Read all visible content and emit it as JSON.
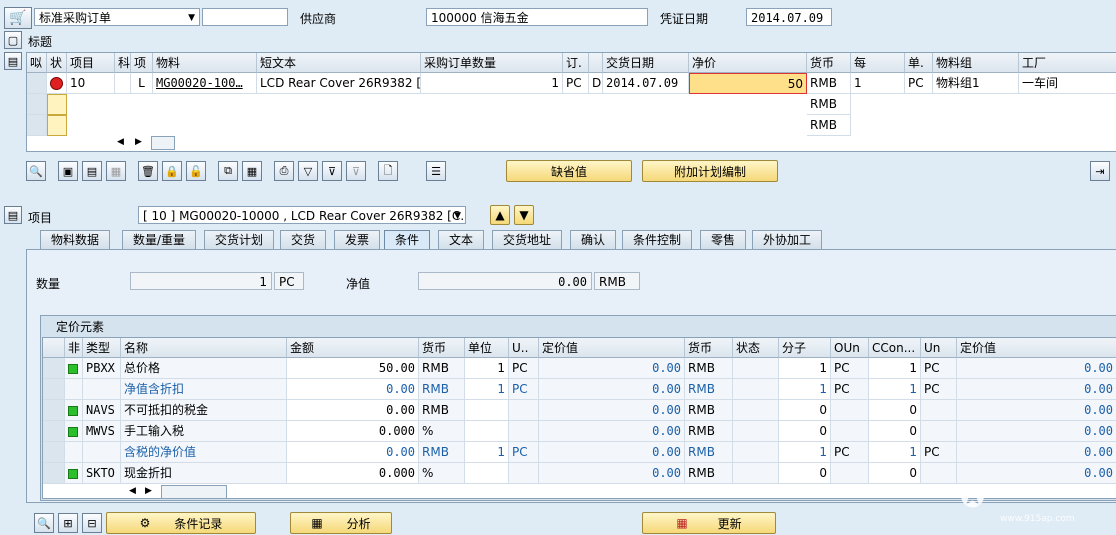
{
  "header": {
    "order_type": "标准采购订单",
    "vendor_label": "供应商",
    "vendor_value": "100000 信海五金",
    "doc_date_label": "凭证日期",
    "doc_date_value": "2014.07.09"
  },
  "title_section": {
    "label": "标题"
  },
  "items_table": {
    "columns": [
      "㕽",
      "状",
      "项目",
      "科",
      "项",
      "物料",
      "短文本",
      "采购订单数量",
      "订.",
      "",
      "交货日期",
      "净价",
      "货币",
      "每",
      "单.",
      "物料组",
      "工厂"
    ],
    "row": {
      "item": "10",
      "acct": "",
      "type": "L",
      "material": "MG00020-100…",
      "short_text": "LCD Rear Cover 26R9382 [C…",
      "qty": "1",
      "unit": "PC",
      "d": "D",
      "delivery_date": "2014.07.09",
      "net_price": "50",
      "currency": "RMB",
      "per": "1",
      "order_unit": "PC",
      "material_group": "物料组1",
      "plant": "一车间"
    },
    "empty_currency": [
      "RMB",
      "RMB"
    ]
  },
  "toolbar": {
    "default_values": "缺省值",
    "additional_planning": "附加计划编制"
  },
  "item_section": {
    "label": "项目",
    "item_select": "[ 10 ] MG00020-10000 , LCD Rear Cover 26R9382 [C…"
  },
  "tabs": [
    "物料数据",
    "数量/重量",
    "交货计划",
    "交货",
    "发票",
    "条件",
    "文本",
    "交货地址",
    "确认",
    "条件控制",
    "零售",
    "外协加工"
  ],
  "active_tab": "条件",
  "conditions": {
    "qty_label": "数量",
    "qty_value": "1",
    "qty_unit": "PC",
    "net_label": "净值",
    "net_value": "0.00",
    "net_currency": "RMB"
  },
  "pricing": {
    "title": "定价元素",
    "columns": [
      "非",
      "类型",
      "名称",
      "金额",
      "货币",
      "单位",
      "U..",
      "定价值",
      "货币",
      "状态",
      "分子",
      "OUn",
      "CCon...",
      "Un",
      "定价值"
    ],
    "rows": [
      {
        "led": true,
        "type": "PBXX",
        "name": "总价格",
        "amount": "50.00",
        "currency": "RMB",
        "unit": "1",
        "u": "PC",
        "value": "0.00",
        "vcur": "RMB",
        "status": "",
        "num": "1",
        "oun": "PC",
        "ccon": "1",
        "un": "PC",
        "value2": "0.00",
        "blue": false
      },
      {
        "led": false,
        "type": "",
        "name": "净值含折扣",
        "amount": "0.00",
        "currency": "RMB",
        "unit": "1",
        "u": "PC",
        "value": "0.00",
        "vcur": "RMB",
        "status": "",
        "num": "1",
        "oun": "PC",
        "ccon": "1",
        "un": "PC",
        "value2": "0.00",
        "blue": true
      },
      {
        "led": true,
        "type": "NAVS",
        "name": "不可抵扣的税金",
        "amount": "0.00",
        "currency": "RMB",
        "unit": "",
        "u": "",
        "value": "0.00",
        "vcur": "RMB",
        "status": "",
        "num": "0",
        "oun": "",
        "ccon": "0",
        "un": "",
        "value2": "0.00",
        "blue": false
      },
      {
        "led": true,
        "type": "MWVS",
        "name": "手工输入税",
        "amount": "0.000",
        "currency": "%",
        "unit": "",
        "u": "",
        "value": "0.00",
        "vcur": "RMB",
        "status": "",
        "num": "0",
        "oun": "",
        "ccon": "0",
        "un": "",
        "value2": "0.00",
        "blue": false
      },
      {
        "led": false,
        "type": "",
        "name": "含税的净价值",
        "amount": "0.00",
        "currency": "RMB",
        "unit": "1",
        "u": "PC",
        "value": "0.00",
        "vcur": "RMB",
        "status": "",
        "num": "1",
        "oun": "PC",
        "ccon": "1",
        "un": "PC",
        "value2": "0.00",
        "blue": true
      },
      {
        "led": true,
        "type": "SKTO",
        "name": "现金折扣",
        "amount": "0.000",
        "currency": "%",
        "unit": "",
        "u": "",
        "value": "0.00",
        "vcur": "RMB",
        "status": "",
        "num": "0",
        "oun": "",
        "ccon": "0",
        "un": "",
        "value2": "0.00",
        "blue": false
      }
    ]
  },
  "bottom": {
    "condition_record": "条件记录",
    "analysis": "分析",
    "update": "更新"
  },
  "watermark": "www.915ap.com"
}
